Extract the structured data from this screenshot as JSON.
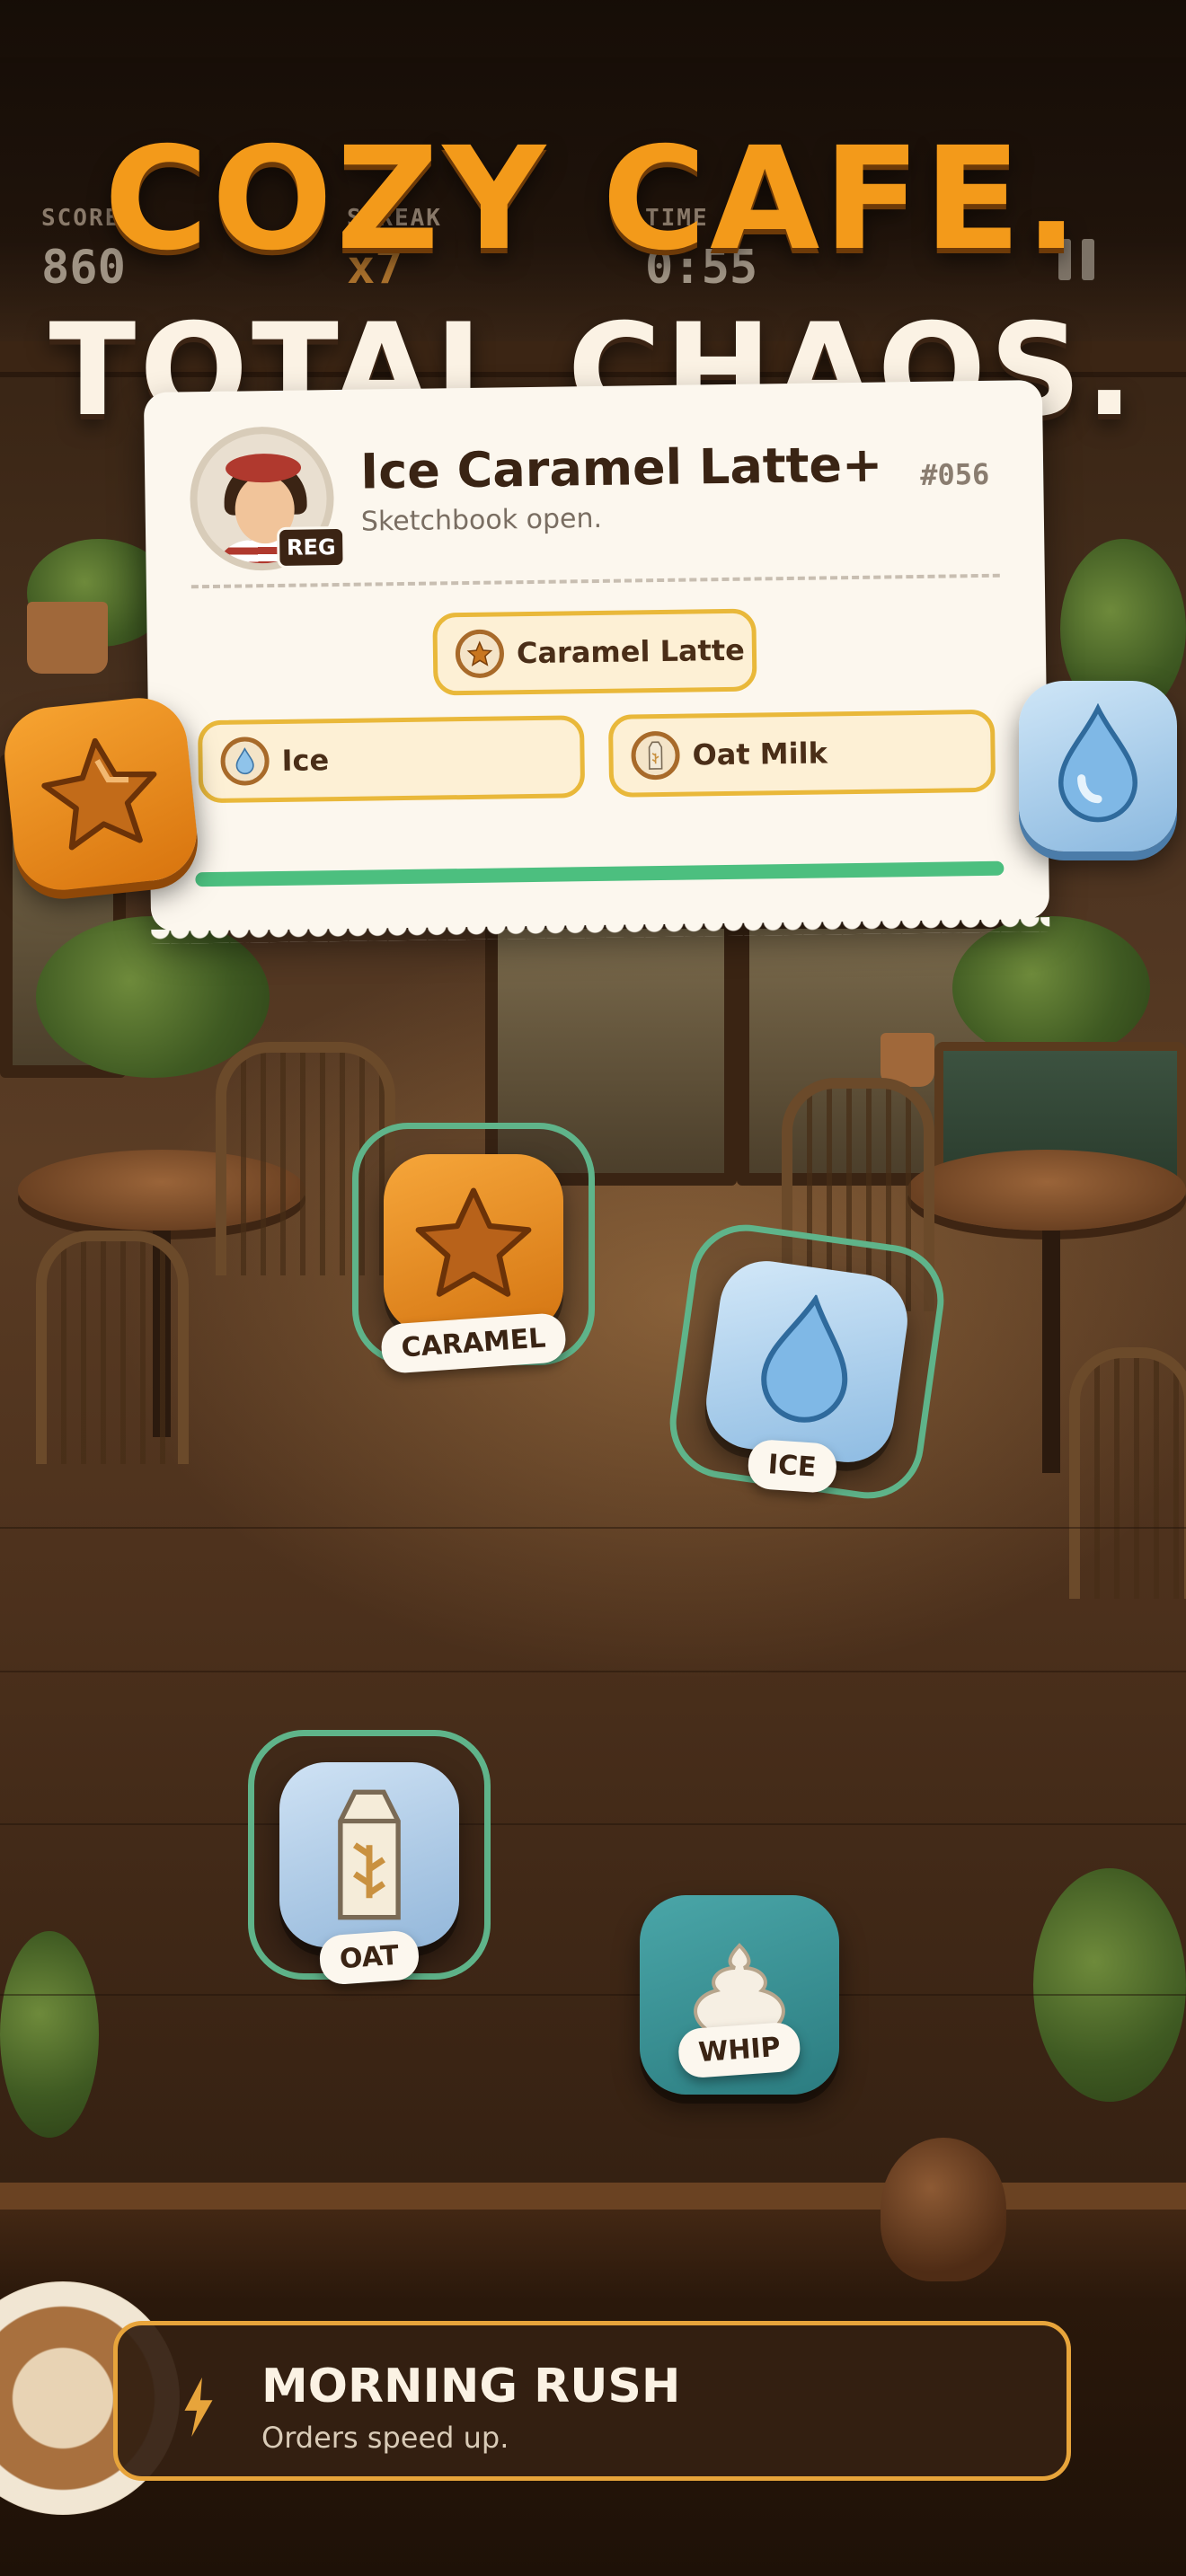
{
  "hud": {
    "score_label": "SCORE",
    "score_value": "860",
    "streak_label": "STREAK",
    "streak_value": "x7",
    "time_label": "TIME",
    "time_value": "0:55"
  },
  "headline": {
    "line1": "COZY CAFE.",
    "line2": "TOTAL CHAOS."
  },
  "order": {
    "title": "Ice Caramel Latte+",
    "subtitle": "Sketchbook open.",
    "number": "#056",
    "customer_badge": "REG",
    "base_chip": "Caramel Latte",
    "extra_chips": [
      "Ice",
      "Oat Milk"
    ],
    "progress_fraction": 1.0,
    "progress_color": "#4cbf7f"
  },
  "ingredients": [
    {
      "label": "CARAMEL",
      "icon": "caramel-star-icon",
      "selected": true
    },
    {
      "label": "ICE",
      "icon": "ice-drop-icon",
      "selected": true
    },
    {
      "label": "OAT",
      "icon": "oat-milk-carton-icon",
      "selected": true
    },
    {
      "label": "WHIP",
      "icon": "whipped-cream-icon",
      "selected": false
    }
  ],
  "side_icons": [
    "caramel-star-icon",
    "ice-drop-icon"
  ],
  "banner": {
    "title": "MORNING RUSH",
    "subtitle": "Orders speed up.",
    "icon": "lightning-bolt-icon"
  },
  "colors": {
    "accent_orange": "#f39a1a",
    "selection_green": "#5fb48a",
    "chip_border": "#e9b83a",
    "banner_border": "#e7a43b"
  }
}
